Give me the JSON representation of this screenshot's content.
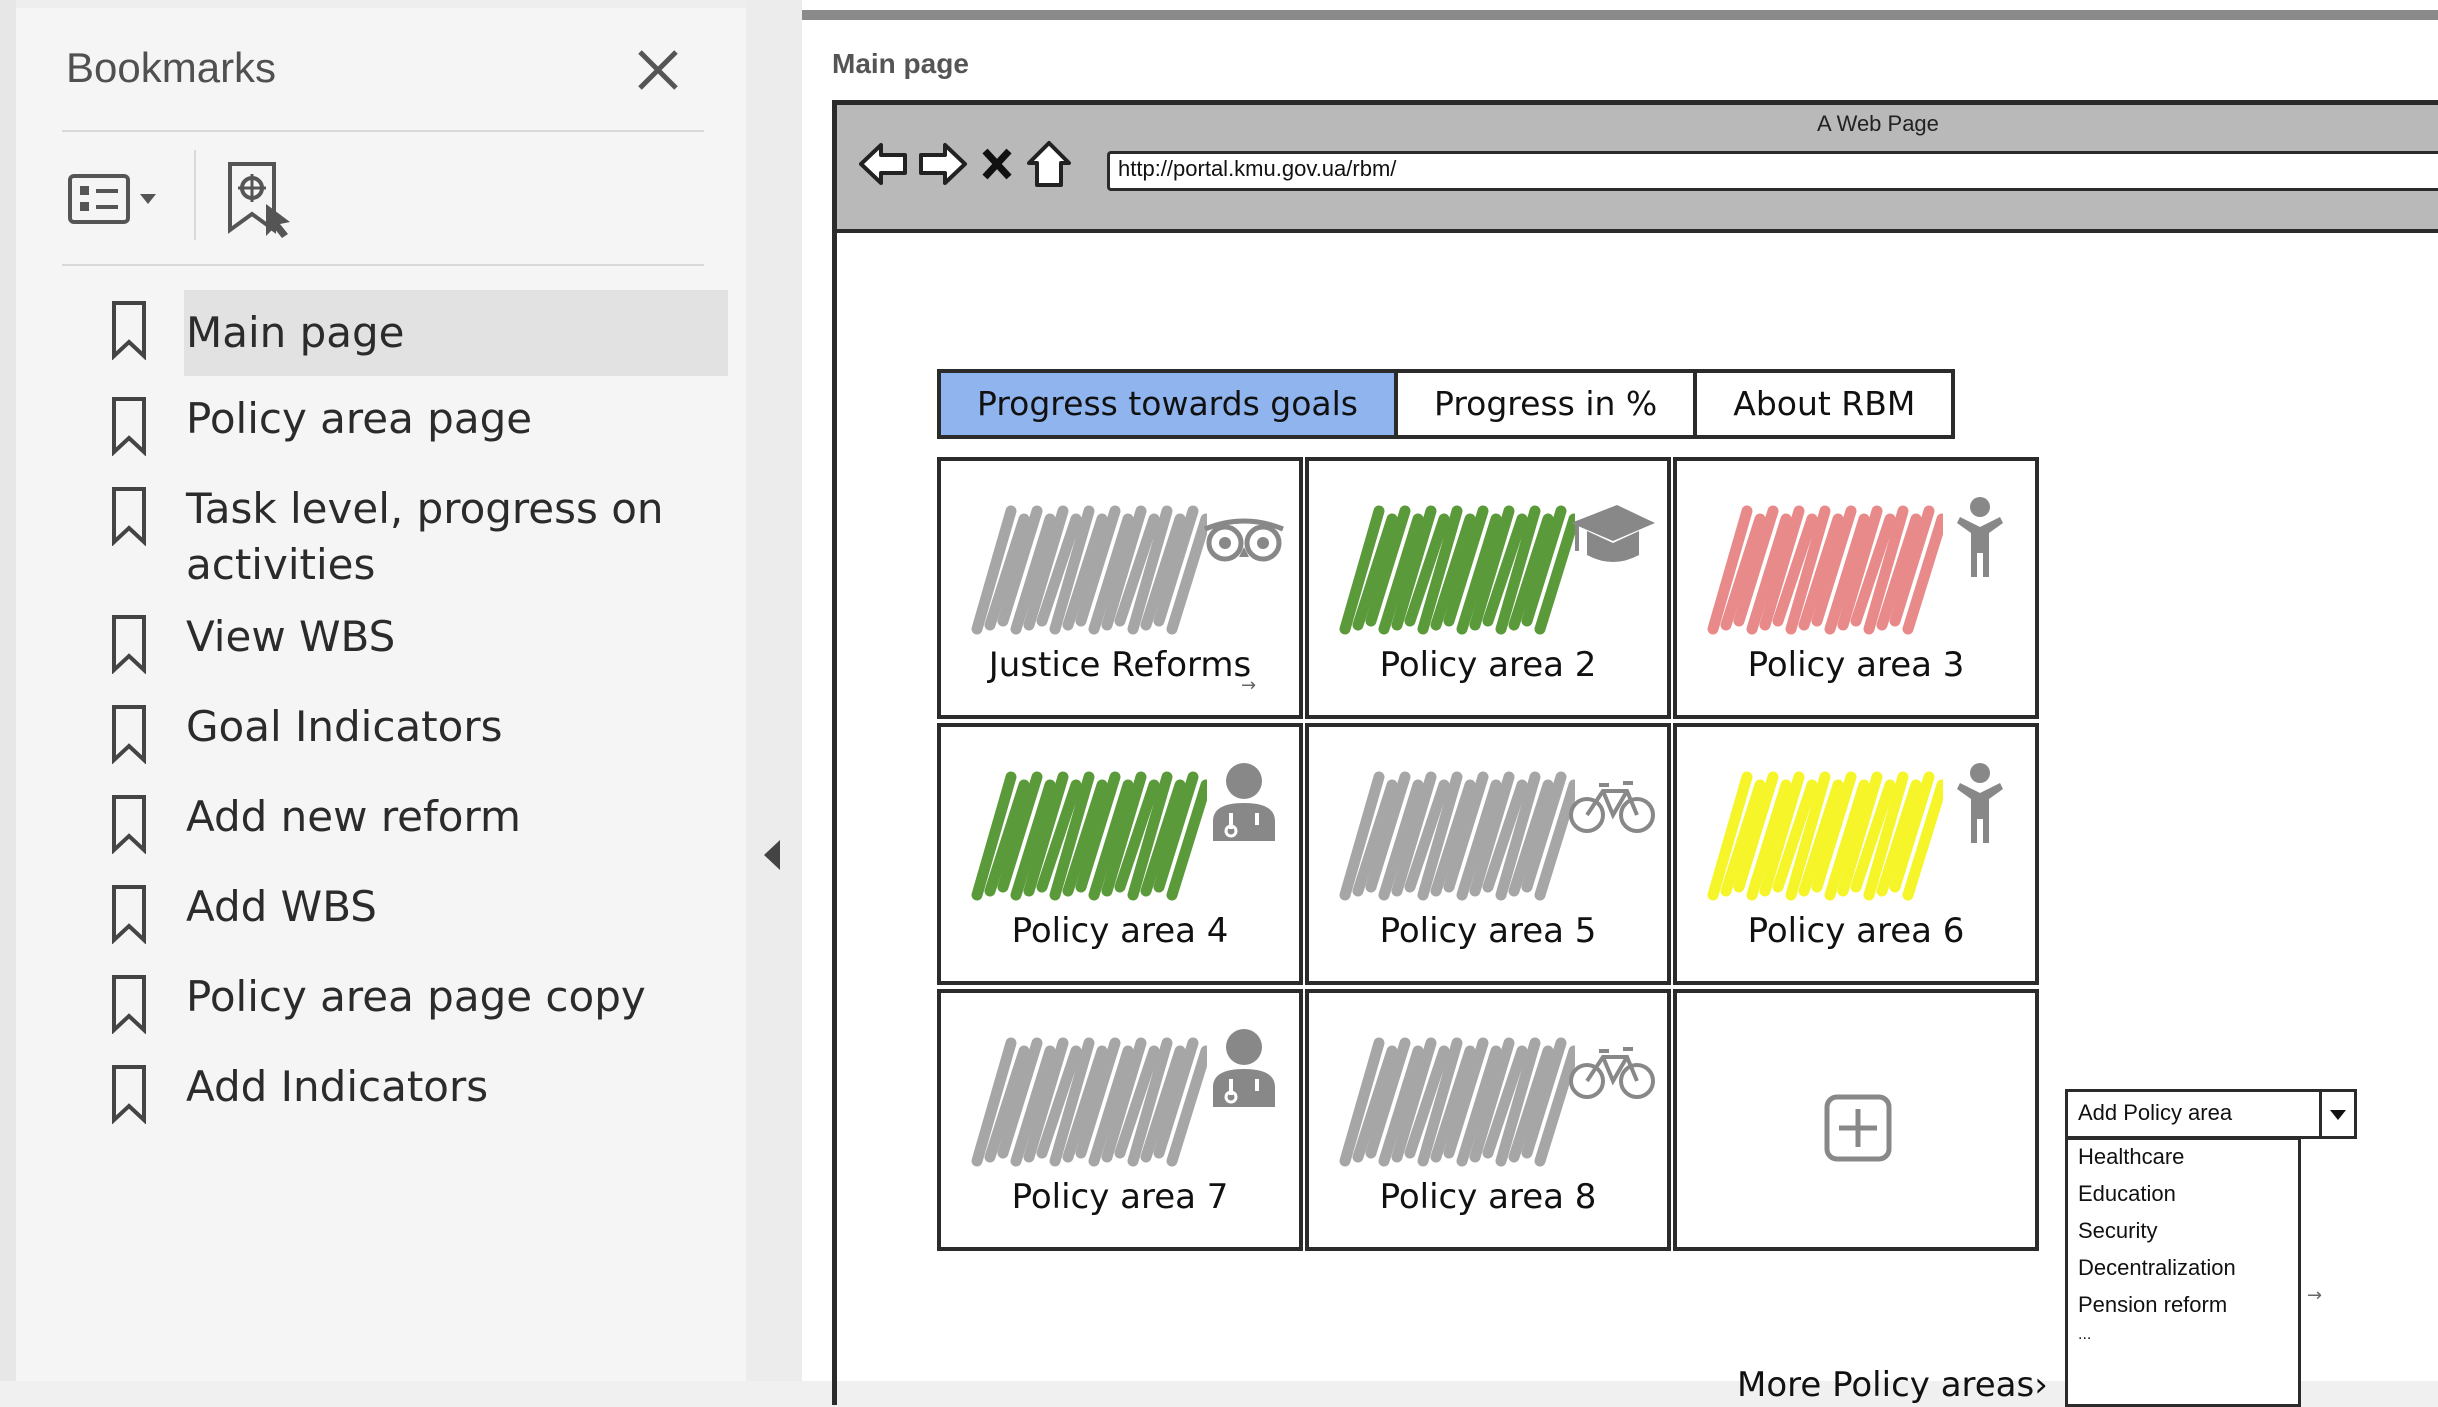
{
  "bookmarks": {
    "title": "Bookmarks",
    "items": [
      {
        "label": "Main page"
      },
      {
        "label": "Policy area page"
      },
      {
        "label": "Task level, progress on"
      },
      {
        "label": "activities"
      },
      {
        "label": "View WBS"
      },
      {
        "label": "Goal Indicators"
      },
      {
        "label": "Add new reform"
      },
      {
        "label": "Add WBS"
      },
      {
        "label": "Policy area page copy"
      },
      {
        "label": "Add Indicators"
      }
    ]
  },
  "page": {
    "caption": "Main page",
    "window_title": "A Web Page",
    "url": "http://portal.kmu.gov.ua/rbm/"
  },
  "tabs": [
    {
      "label": "Progress towards goals",
      "active": true
    },
    {
      "label": "Progress in %",
      "active": false
    },
    {
      "label": "About RBM",
      "active": false
    }
  ],
  "tiles": [
    {
      "label": "Justice Reforms",
      "color": "#a6a6a6",
      "icon": "owl-icon"
    },
    {
      "label": "Policy area 2",
      "color": "#5a9a3a",
      "icon": "graduation-cap-icon"
    },
    {
      "label": "Policy area 3",
      "color": "#e98a8a",
      "icon": "person-icon"
    },
    {
      "label": "Policy area 4",
      "color": "#5a9a3a",
      "icon": "doctor-icon"
    },
    {
      "label": "Policy area 5",
      "color": "#a6a6a6",
      "icon": "bicycle-icon"
    },
    {
      "label": "Policy area 6",
      "color": "#f5f52a",
      "icon": "person-icon"
    },
    {
      "label": "Policy area 7",
      "color": "#a6a6a6",
      "icon": "doctor-icon"
    },
    {
      "label": "Policy area 8",
      "color": "#a6a6a6",
      "icon": "bicycle-icon"
    }
  ],
  "more_link": "More Policy areas",
  "more_link_arrow": "›",
  "dropdown": {
    "value": "Add Policy area",
    "options": [
      "Healthcare",
      "Education",
      "Security",
      "Decentralization",
      "Pension reform",
      "..."
    ]
  }
}
